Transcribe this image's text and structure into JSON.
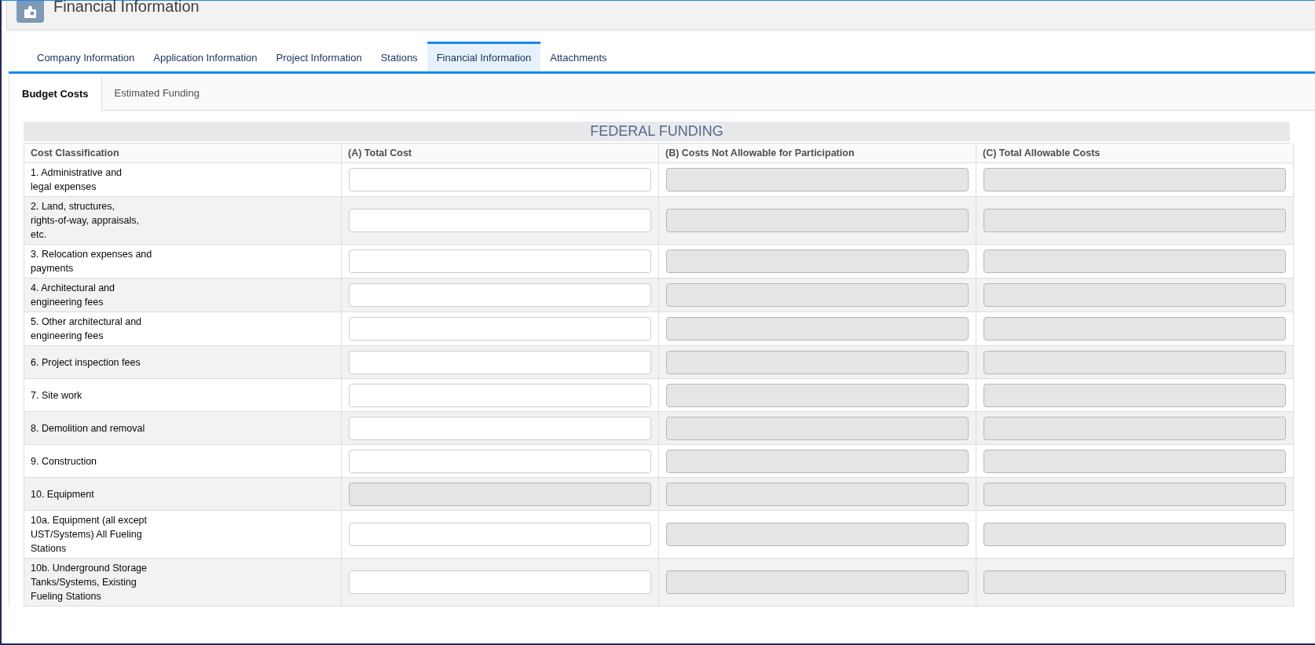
{
  "header": {
    "title": "Financial Information"
  },
  "tabs": [
    {
      "label": "Company Information",
      "selected": false
    },
    {
      "label": "Application Information",
      "selected": false
    },
    {
      "label": "Project Information",
      "selected": false
    },
    {
      "label": "Stations",
      "selected": false
    },
    {
      "label": "Financial Information",
      "selected": true
    },
    {
      "label": "Attachments",
      "selected": false
    }
  ],
  "subtabs": [
    {
      "label": "Budget Costs",
      "selected": true
    },
    {
      "label": "Estimated Funding",
      "selected": false
    }
  ],
  "table": {
    "title": "FEDERAL FUNDING",
    "columns": [
      "Cost Classification",
      "(A) Total Cost",
      "(B) Costs Not Allowable for Participation",
      "(C) Total Allowable Costs"
    ],
    "rows": [
      {
        "label": "1. Administrative and\nlegal expenses",
        "fields": [
          {
            "disabled": false
          },
          {
            "disabled": true
          },
          {
            "disabled": true
          }
        ]
      },
      {
        "label": "2. Land, structures,\nrights-of-way, appraisals,\netc.",
        "fields": [
          {
            "disabled": false
          },
          {
            "disabled": true
          },
          {
            "disabled": true
          }
        ]
      },
      {
        "label": "3. Relocation expenses and\npayments",
        "fields": [
          {
            "disabled": false
          },
          {
            "disabled": true
          },
          {
            "disabled": true
          }
        ]
      },
      {
        "label": "4. Architectural and\nengineering fees",
        "fields": [
          {
            "disabled": false
          },
          {
            "disabled": true
          },
          {
            "disabled": true
          }
        ]
      },
      {
        "label": "5. Other architectural and\nengineering fees",
        "fields": [
          {
            "disabled": false
          },
          {
            "disabled": true
          },
          {
            "disabled": true
          }
        ]
      },
      {
        "label": "6. Project inspection fees",
        "fields": [
          {
            "disabled": false
          },
          {
            "disabled": true
          },
          {
            "disabled": true
          }
        ]
      },
      {
        "label": "7. Site work",
        "fields": [
          {
            "disabled": false
          },
          {
            "disabled": true
          },
          {
            "disabled": true
          }
        ]
      },
      {
        "label": "8. Demolition and removal",
        "fields": [
          {
            "disabled": false
          },
          {
            "disabled": true
          },
          {
            "disabled": true
          }
        ]
      },
      {
        "label": "9. Construction",
        "fields": [
          {
            "disabled": false
          },
          {
            "disabled": true
          },
          {
            "disabled": true
          }
        ]
      },
      {
        "label": "10. Equipment",
        "fields": [
          {
            "disabled": true
          },
          {
            "disabled": true
          },
          {
            "disabled": true
          }
        ]
      },
      {
        "label": "10a. Equipment (all except\nUST/Systems) All Fueling\nStations",
        "fields": [
          {
            "disabled": false
          },
          {
            "disabled": true
          },
          {
            "disabled": true
          }
        ]
      },
      {
        "label": "10b. Underground Storage\nTanks/Systems, Existing\nFueling Stations",
        "fields": [
          {
            "disabled": false
          },
          {
            "disabled": true
          },
          {
            "disabled": true
          }
        ]
      }
    ]
  }
}
